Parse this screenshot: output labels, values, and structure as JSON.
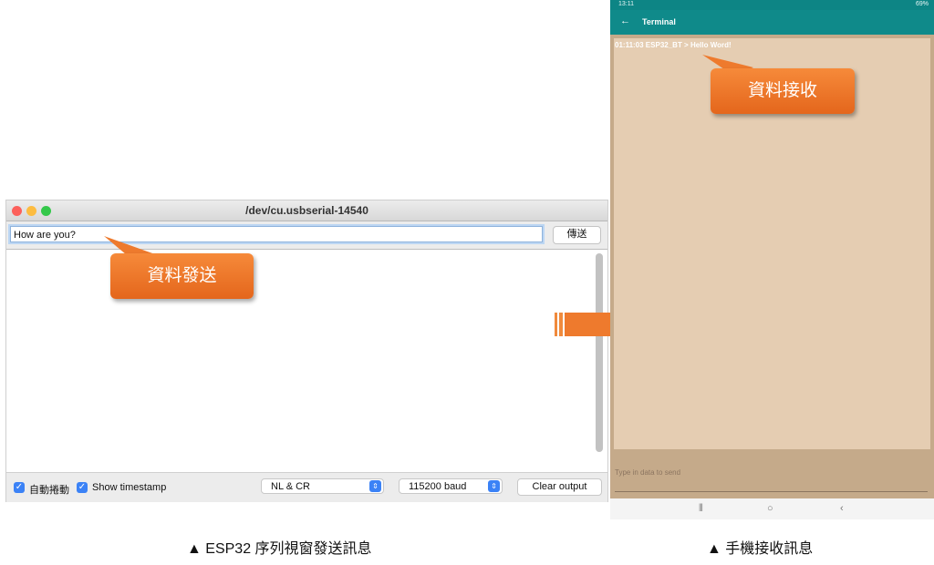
{
  "serial_monitor": {
    "window_title": "/dev/cu.usbserial-14540",
    "input_value": "How are you?",
    "send_label": "傳送",
    "autoscroll_label": "自動捲動",
    "timestamp_label": "Show timestamp",
    "line_ending": "NL & CR",
    "baud_rate": "115200 baud",
    "clear_label": "Clear output",
    "traffic_light_colors": [
      "#fc605b",
      "#fdbc40",
      "#34c84a"
    ]
  },
  "callouts": {
    "send": "資料發送",
    "receive": "資料接收",
    "color": "#ee7a2d"
  },
  "phone": {
    "status_time": "13:11",
    "status_right": "69%",
    "app_title": "Terminal",
    "terminal_line": "01:11:03 ESP32_BT > Hello Word!",
    "input_placeholder": "Type in data to send",
    "accent_color": "#0f8a8a"
  },
  "captions": {
    "left": "▲  ESP32 序列視窗發送訊息",
    "right": "▲  手機接收訊息"
  }
}
